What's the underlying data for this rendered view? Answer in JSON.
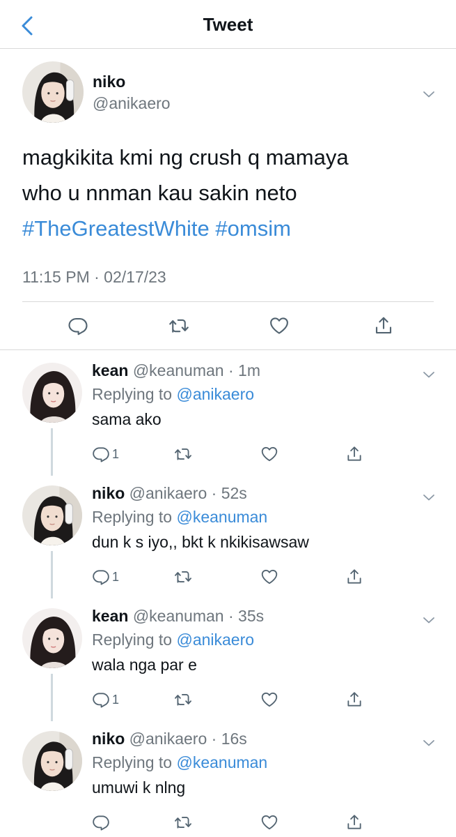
{
  "header": {
    "title": "Tweet"
  },
  "tweet": {
    "name": "niko",
    "handle": "@anikaero",
    "text_line1": "magkikita kmi ng crush q mamaya",
    "text_line2": "who u nnman kau sakin neto",
    "hashtag1": "#TheGreatestWhite",
    "hashtag2": "#omsim",
    "timestamp": "11:15 PM · 02/17/23"
  },
  "replies": [
    {
      "name": "kean",
      "handle": "@keanuman",
      "time": "1m",
      "replying_label": "Replying to",
      "mention": "@anikaero",
      "text": "sama ako",
      "reply_count": "1"
    },
    {
      "name": "niko",
      "handle": "@anikaero",
      "time": "52s",
      "replying_label": "Replying to",
      "mention": "@keanuman",
      "text": "dun k s iyo,, bkt k nkikisawsaw",
      "reply_count": "1"
    },
    {
      "name": "kean",
      "handle": "@keanuman",
      "time": "35s",
      "replying_label": "Replying to",
      "mention": "@anikaero",
      "text": "wala nga par e",
      "reply_count": "1"
    },
    {
      "name": "niko",
      "handle": "@anikaero",
      "time": "16s",
      "replying_label": "Replying to",
      "mention": "@keanuman",
      "text": "umuwi k nlng",
      "reply_count": ""
    }
  ],
  "colors": {
    "accent": "#3a8bd8",
    "secondary_text": "#6e767d",
    "divider": "#d9d9d9",
    "thread_line": "#cfd9de"
  },
  "icons": [
    "back-chevron-icon",
    "chevron-down-icon",
    "reply-icon",
    "retweet-icon",
    "like-icon",
    "share-icon"
  ]
}
